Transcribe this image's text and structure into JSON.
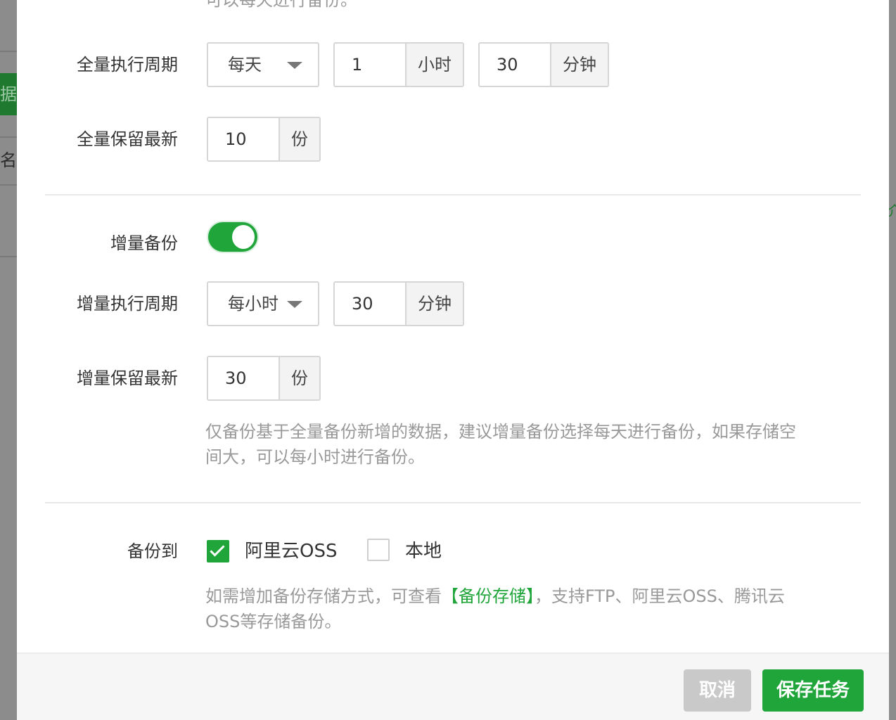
{
  "background": {
    "left_green_fragment": "据库",
    "left_text_fragment": "名/表"
  },
  "form": {
    "top_cut_text": "可以每天进行备份。",
    "full_cycle": {
      "label": "全量执行周期",
      "period_select": "每天",
      "hour_value": "1",
      "hour_unit": "小时",
      "minute_value": "30",
      "minute_unit": "分钟"
    },
    "full_keep": {
      "label": "全量保留最新",
      "value": "10",
      "unit": "份"
    },
    "incremental": {
      "label": "增量备份",
      "enabled": true
    },
    "inc_cycle": {
      "label": "增量执行周期",
      "period_select": "每小时",
      "minute_value": "30",
      "minute_unit": "分钟"
    },
    "inc_keep": {
      "label": "增量保留最新",
      "value": "30",
      "unit": "份",
      "help_line1": "仅备份基于全量备份新增的数据，建议增量备份选择每天进行备份，如果存储空",
      "help_line2": "间大，可以每小时进行备份。"
    },
    "backup_to": {
      "label": "备份到",
      "options": [
        {
          "label": "阿里云OSS",
          "checked": true
        },
        {
          "label": "本地",
          "checked": false
        }
      ],
      "help_before_link": "如需增加备份存储方式，可查看",
      "help_link": "【备份存储】",
      "help_after_link": "，支持FTP、阿里云OSS、腾讯云",
      "help_line2": "OSS等存储备份。"
    }
  },
  "footer": {
    "cancel_label": "取消",
    "save_label": "保存任务"
  },
  "colors": {
    "accent": "#20a53a",
    "help_text": "#999999",
    "cancel_bg": "#c9c9c9"
  }
}
